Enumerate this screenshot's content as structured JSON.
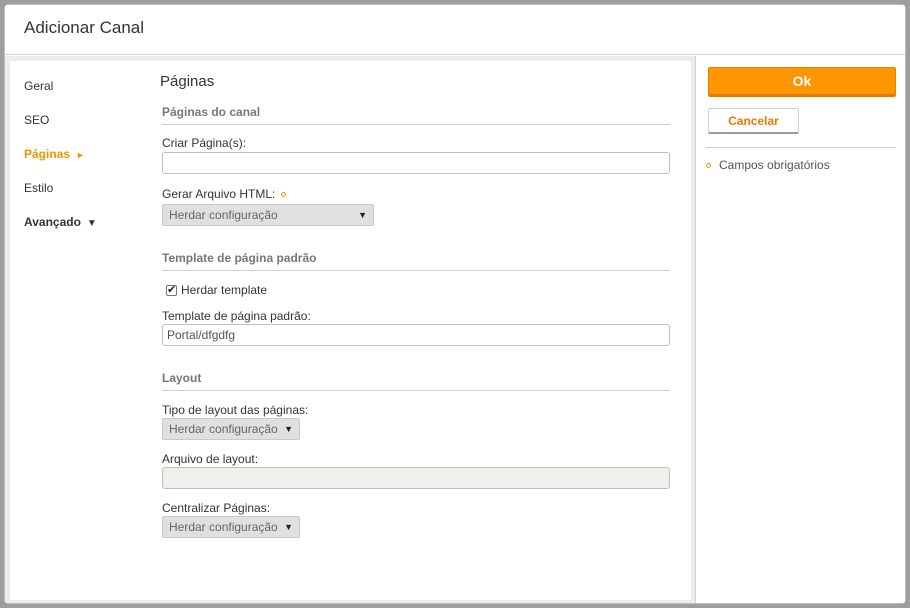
{
  "dialog": {
    "title": "Adicionar Canal"
  },
  "nav": {
    "items": [
      {
        "label": "Geral"
      },
      {
        "label": "SEO"
      },
      {
        "label": "Páginas",
        "arrow": "►"
      },
      {
        "label": "Estilo"
      },
      {
        "label": "Avançado",
        "caret": "▼"
      }
    ]
  },
  "main": {
    "page_title": "Páginas",
    "sections": {
      "paginas_canal": {
        "title": "Páginas do canal",
        "criar_label": "Criar Página(s):",
        "criar_value": "",
        "gerar_label": "Gerar Arquivo HTML:",
        "gerar_value": "Herdar configuração"
      },
      "template": {
        "title": "Template de página padrão",
        "herdar_label": "Herdar template",
        "herdar_checked": true,
        "template_label": "Template de página padrão:",
        "template_value": "Portal/dfgdfg"
      },
      "layout": {
        "title": "Layout",
        "tipo_label": "Tipo de layout das páginas:",
        "tipo_value": "Herdar configuração",
        "arquivo_label": "Arquivo de layout:",
        "arquivo_value": "",
        "centralizar_label": "Centralizar Páginas:",
        "centralizar_value": "Herdar configuração"
      }
    }
  },
  "sidebar": {
    "ok_label": "Ok",
    "cancel_label": "Cancelar",
    "required_note": "Campos obrigatórios"
  },
  "colors": {
    "accent": "#ff9600",
    "active_nav": "#f29400",
    "cancel_text": "#f07800"
  },
  "icons": {
    "select_caret": "▼",
    "checkmark": "✔"
  }
}
